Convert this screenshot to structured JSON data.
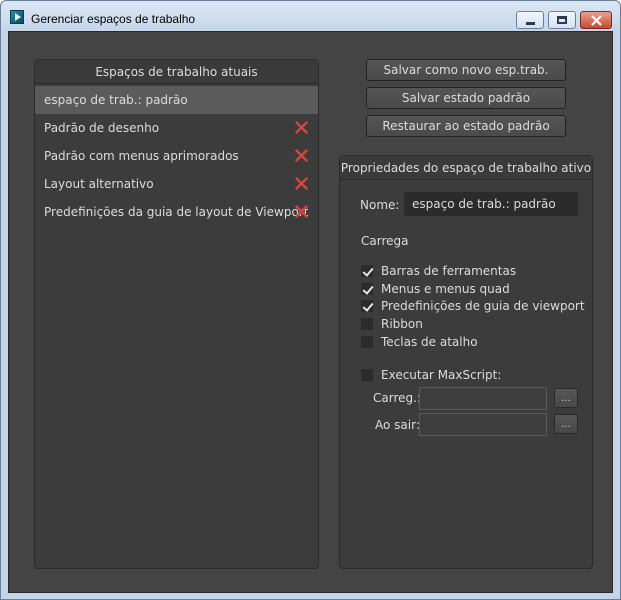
{
  "window": {
    "title": "Gerenciar espaços de trabalho"
  },
  "workspaces": {
    "header": "Espaços de trabalho atuais",
    "items": [
      {
        "label": "espaço de trab.: padrão"
      },
      {
        "label": "Padrão de desenho"
      },
      {
        "label": "Padrão com menus aprimorados"
      },
      {
        "label": "Layout alternativo"
      },
      {
        "label": "Predefinições da guia de layout de Viewport"
      }
    ]
  },
  "actions": {
    "save_new": "Salvar como novo esp.trab.",
    "save_default": "Salvar estado padrão",
    "restore_default": "Restaurar ao estado padrão"
  },
  "properties": {
    "header": "Propriedades do espaço de trabalho ativo",
    "name_label": "Nome:",
    "name_value": "espaço de trab.: padrão",
    "loads_label": "Carrega",
    "options": [
      {
        "label": "Barras de ferramentas",
        "checked": true
      },
      {
        "label": "Menus e menus quad",
        "checked": true
      },
      {
        "label": "Predefinições de guia de viewport",
        "checked": true
      },
      {
        "label": "Ribbon",
        "checked": false
      },
      {
        "label": "Teclas de atalho",
        "checked": false
      }
    ],
    "maxscript": {
      "label": "Executar MaxScript:",
      "checked": false,
      "load_label": "Carreg.:",
      "exit_label": "Ao sair:",
      "browse_label": "..."
    }
  },
  "colors": {
    "delete_icon": "#e0403a",
    "background": "#444444",
    "selected_row": "#5b5b5b"
  }
}
